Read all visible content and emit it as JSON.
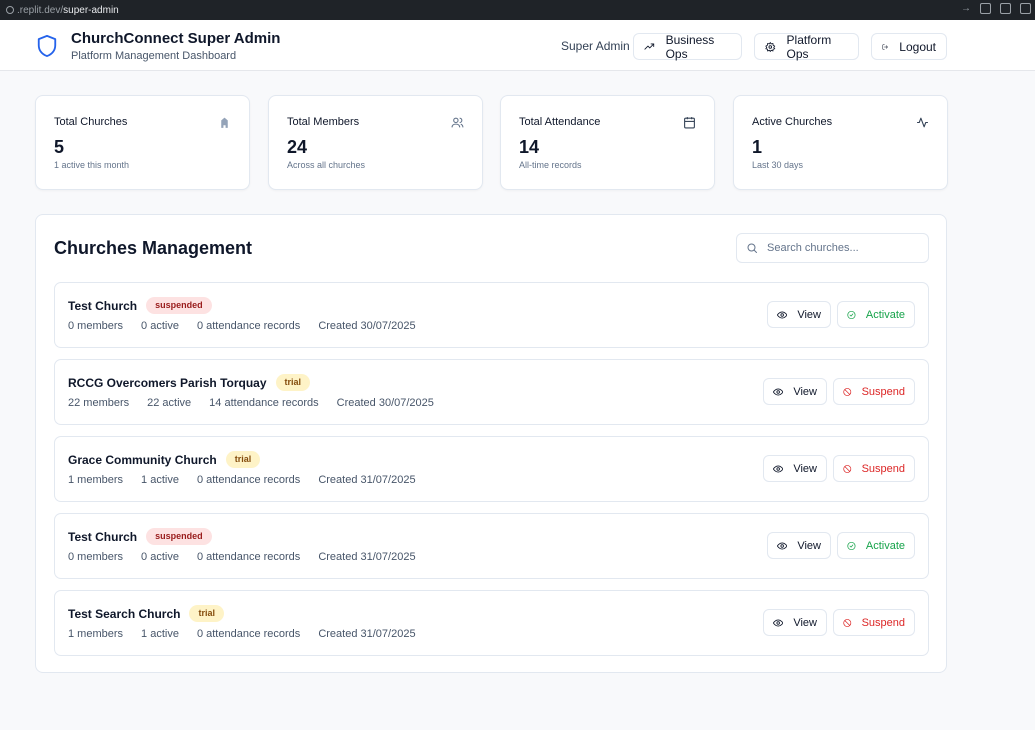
{
  "browser": {
    "url_prefix": ".replit.dev/",
    "url_path": "super-admin"
  },
  "header": {
    "title": "ChurchConnect Super Admin",
    "subtitle": "Platform Management Dashboard",
    "user_label": "Super Admin",
    "business_ops_label": "Business Ops",
    "platform_ops_label": "Platform Ops",
    "logout_label": "Logout"
  },
  "stats": [
    {
      "label": "Total Churches",
      "value": "5",
      "sub": "1 active this month",
      "icon": "building-icon"
    },
    {
      "label": "Total Members",
      "value": "24",
      "sub": "Across all churches",
      "icon": "users-icon"
    },
    {
      "label": "Total Attendance",
      "value": "14",
      "sub": "All-time records",
      "icon": "calendar-icon"
    },
    {
      "label": "Active Churches",
      "value": "1",
      "sub": "Last 30 days",
      "icon": "activity-icon"
    }
  ],
  "churches": {
    "title": "Churches Management",
    "search_placeholder": "Search churches...",
    "view_label": "View",
    "rows": [
      {
        "name": "Test Church",
        "status": "suspended",
        "members": "0 members",
        "active": "0 active",
        "attendance": "0 attendance records",
        "created": "Created 30/07/2025",
        "action": "Activate"
      },
      {
        "name": "RCCG Overcomers Parish Torquay",
        "status": "trial",
        "members": "22 members",
        "active": "22 active",
        "attendance": "14 attendance records",
        "created": "Created 30/07/2025",
        "action": "Suspend"
      },
      {
        "name": "Grace Community Church",
        "status": "trial",
        "members": "1 members",
        "active": "1 active",
        "attendance": "0 attendance records",
        "created": "Created 31/07/2025",
        "action": "Suspend"
      },
      {
        "name": "Test Church",
        "status": "suspended",
        "members": "0 members",
        "active": "0 active",
        "attendance": "0 attendance records",
        "created": "Created 31/07/2025",
        "action": "Activate"
      },
      {
        "name": "Test Search Church",
        "status": "trial",
        "members": "1 members",
        "active": "1 active",
        "attendance": "0 attendance records",
        "created": "Created 31/07/2025",
        "action": "Suspend"
      }
    ]
  },
  "colors": {
    "brand": "#2563eb",
    "suspend": "#dc2626",
    "activate": "#16a34a",
    "badge_suspended_bg": "#fde2e2",
    "badge_trial_bg": "#fef3c7"
  }
}
